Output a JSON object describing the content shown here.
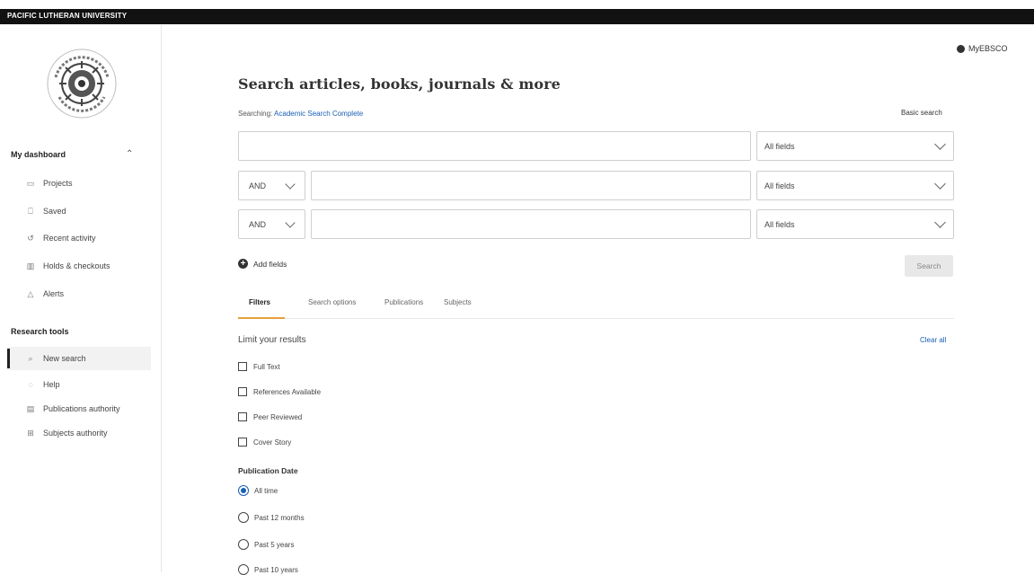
{
  "header": {
    "university": "PACIFIC LUTHERAN UNIVERSITY",
    "account_label": "MyEBSCO"
  },
  "sidebar": {
    "dashboard_heading": "My dashboard",
    "dashboard_items": [
      {
        "label": "Projects",
        "icon": "folder-icon"
      },
      {
        "label": "Saved",
        "icon": "bookmark-icon"
      },
      {
        "label": "Recent activity",
        "icon": "history-icon"
      },
      {
        "label": "Holds & checkouts",
        "icon": "books-icon"
      },
      {
        "label": "Alerts",
        "icon": "bell-icon"
      }
    ],
    "research_heading": "Research tools",
    "research_items": [
      {
        "label": "New search",
        "icon": "search-icon",
        "active": true
      },
      {
        "label": "Help",
        "icon": "help-icon"
      },
      {
        "label": "Publications authority",
        "icon": "document-icon"
      },
      {
        "label": "Subjects authority",
        "icon": "hierarchy-icon"
      }
    ]
  },
  "search": {
    "title": "Search articles, books, journals & more",
    "searching_label": "Searching:",
    "database": "Academic Search Complete",
    "basic_search": "Basic search",
    "rows": [
      {
        "value": "",
        "field": "All fields"
      },
      {
        "operator": "AND",
        "value": "",
        "field": "All fields"
      },
      {
        "operator": "AND",
        "value": "",
        "field": "All fields"
      }
    ],
    "add_fields": "Add fields",
    "search_button": "Search"
  },
  "tabs": [
    "Filters",
    "Search options",
    "Publications",
    "Subjects"
  ],
  "filters": {
    "limit_heading": "Limit your results",
    "clear_all": "Clear all",
    "checkboxes": [
      "Full Text",
      "References Available",
      "Peer Reviewed",
      "Cover Story"
    ],
    "pub_date_heading": "Publication Date",
    "date_options": [
      "All time",
      "Past 12 months",
      "Past 5 years",
      "Past 10 years"
    ],
    "selected_date": "All time"
  },
  "colors": {
    "link": "#1a5fb4",
    "tab_underline": "#e6a03c",
    "topbar": "#111111"
  }
}
